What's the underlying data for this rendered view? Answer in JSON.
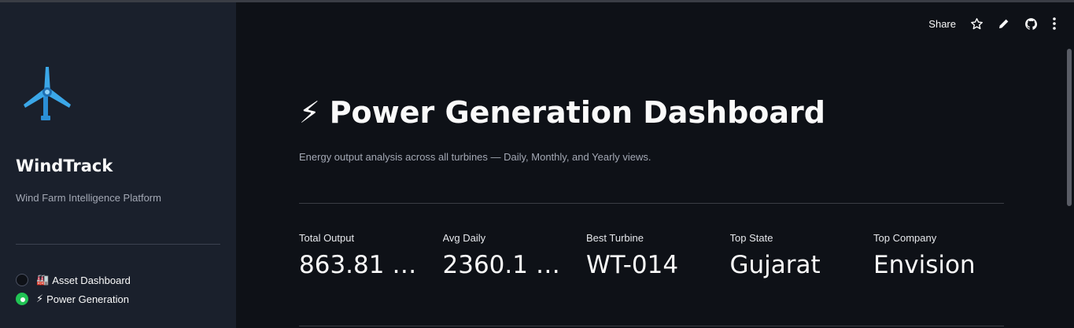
{
  "sidebar": {
    "brand": "WindTrack",
    "tagline": "Wind Farm Intelligence Platform",
    "nav": [
      {
        "icon": "🏭",
        "label": "Asset Dashboard",
        "selected": false
      },
      {
        "icon": "⚡",
        "label": "Power Generation",
        "selected": true
      }
    ]
  },
  "toolbar": {
    "share_label": "Share"
  },
  "main": {
    "title_icon": "⚡",
    "title": "Power Generation Dashboard",
    "subtitle": "Energy output analysis across all turbines — Daily, Monthly, and Yearly views.",
    "metrics": [
      {
        "label": "Total Output",
        "value": "863.81 G…"
      },
      {
        "label": "Avg Daily",
        "value": "2360.1 M…"
      },
      {
        "label": "Best Turbine",
        "value": "WT-014"
      },
      {
        "label": "Top State",
        "value": "Gujarat"
      },
      {
        "label": "Top Company",
        "value": "Envision"
      }
    ]
  },
  "colors": {
    "background": "#0e1117",
    "sidebar": "#1a202c",
    "accent_green": "#21c354",
    "turbine_blue": "#3ba7e8"
  }
}
